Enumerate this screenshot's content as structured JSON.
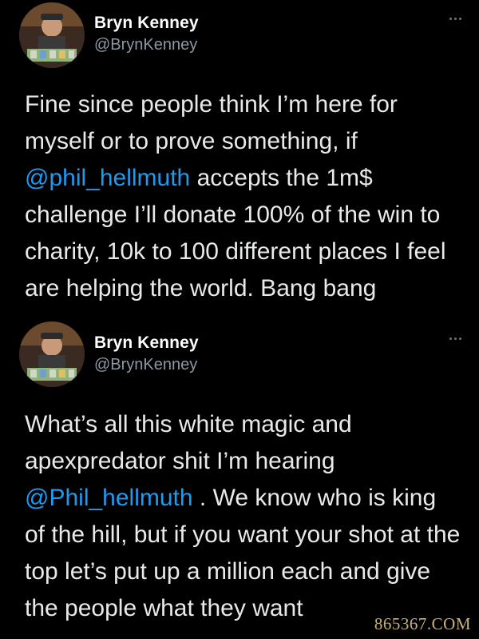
{
  "tweets": [
    {
      "author_name": "Bryn Kenney",
      "author_handle": "@BrynKenney",
      "more_icon": "more-horizontal-icon",
      "text_before": "Fine since people think I’m here for myself or to prove something, if ",
      "mention": "@phil_hellmuth",
      "text_after": " accepts the 1m$ challenge I’ll donate 100% of the win to charity, 10k to 100 different places I feel are helping the world.  Bang bang"
    },
    {
      "author_name": "Bryn Kenney",
      "author_handle": "@BrynKenney",
      "more_icon": "more-horizontal-icon",
      "text_before": "What’s all this white magic and apexpredator shit I’m hearing ",
      "mention": "@Phil_hellmuth",
      "text_after": " .  We know who is king of the hill, but if you want your shot at the top let’s put up a million each and give the people what they want"
    }
  ],
  "watermark": "865367.COM",
  "colors": {
    "background": "#000000",
    "text": "#e7e9ea",
    "mention": "#1d9bf0",
    "handle": "#8b98a5",
    "watermark": "#c8b27a"
  }
}
